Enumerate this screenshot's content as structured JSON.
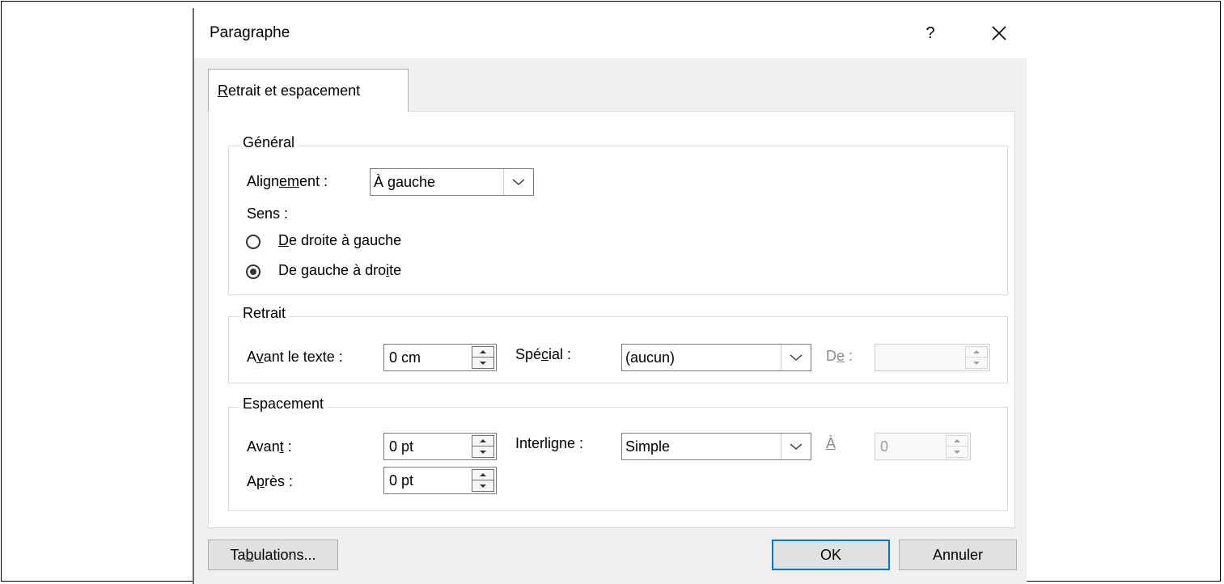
{
  "dialog": {
    "title": "Paragraphe",
    "help_label": "?",
    "close_icon": "close-icon"
  },
  "tabs": [
    {
      "label_ul": "R",
      "label_rest": "etrait et espacement"
    }
  ],
  "general": {
    "title": "Général",
    "alignment_label_pre": "Align",
    "alignment_label_ul": "e",
    "alignment_label_mid": "m",
    "alignment_label_post": "ent :",
    "alignment_value": "À gauche",
    "direction_label": "Sens :",
    "rtl_ul": "D",
    "rtl_rest": "e droite à gauche",
    "ltr_pre": "De gauche à dro",
    "ltr_ul": "i",
    "ltr_post": "te",
    "ltr_checked": true
  },
  "indent": {
    "title": "Retrait",
    "before_pre": "A",
    "before_ul": "v",
    "before_post": "ant le texte :",
    "before_value": "0 cm",
    "special_pre": "Spé",
    "special_ul": "c",
    "special_post": "ial :",
    "special_value": "(aucun)",
    "by_pre": "D",
    "by_ul": "e",
    "by_post": " :",
    "by_value": ""
  },
  "spacing": {
    "title": "Espacement",
    "before_pre": "Avan",
    "before_ul": "t",
    "before_post": " :",
    "before_value": "0 pt",
    "after_pre": "A",
    "after_ul": "p",
    "after_post": "rès :",
    "after_value": "0 pt",
    "line_pre": "Interli",
    "line_ul": "g",
    "line_post": "ne :",
    "line_value": "Simple",
    "at_ul": "À",
    "at_value": "0"
  },
  "buttons": {
    "tabs_pre": "Ta",
    "tabs_ul": "b",
    "tabs_post": "ulations...",
    "ok": "OK",
    "cancel": "Annuler"
  }
}
